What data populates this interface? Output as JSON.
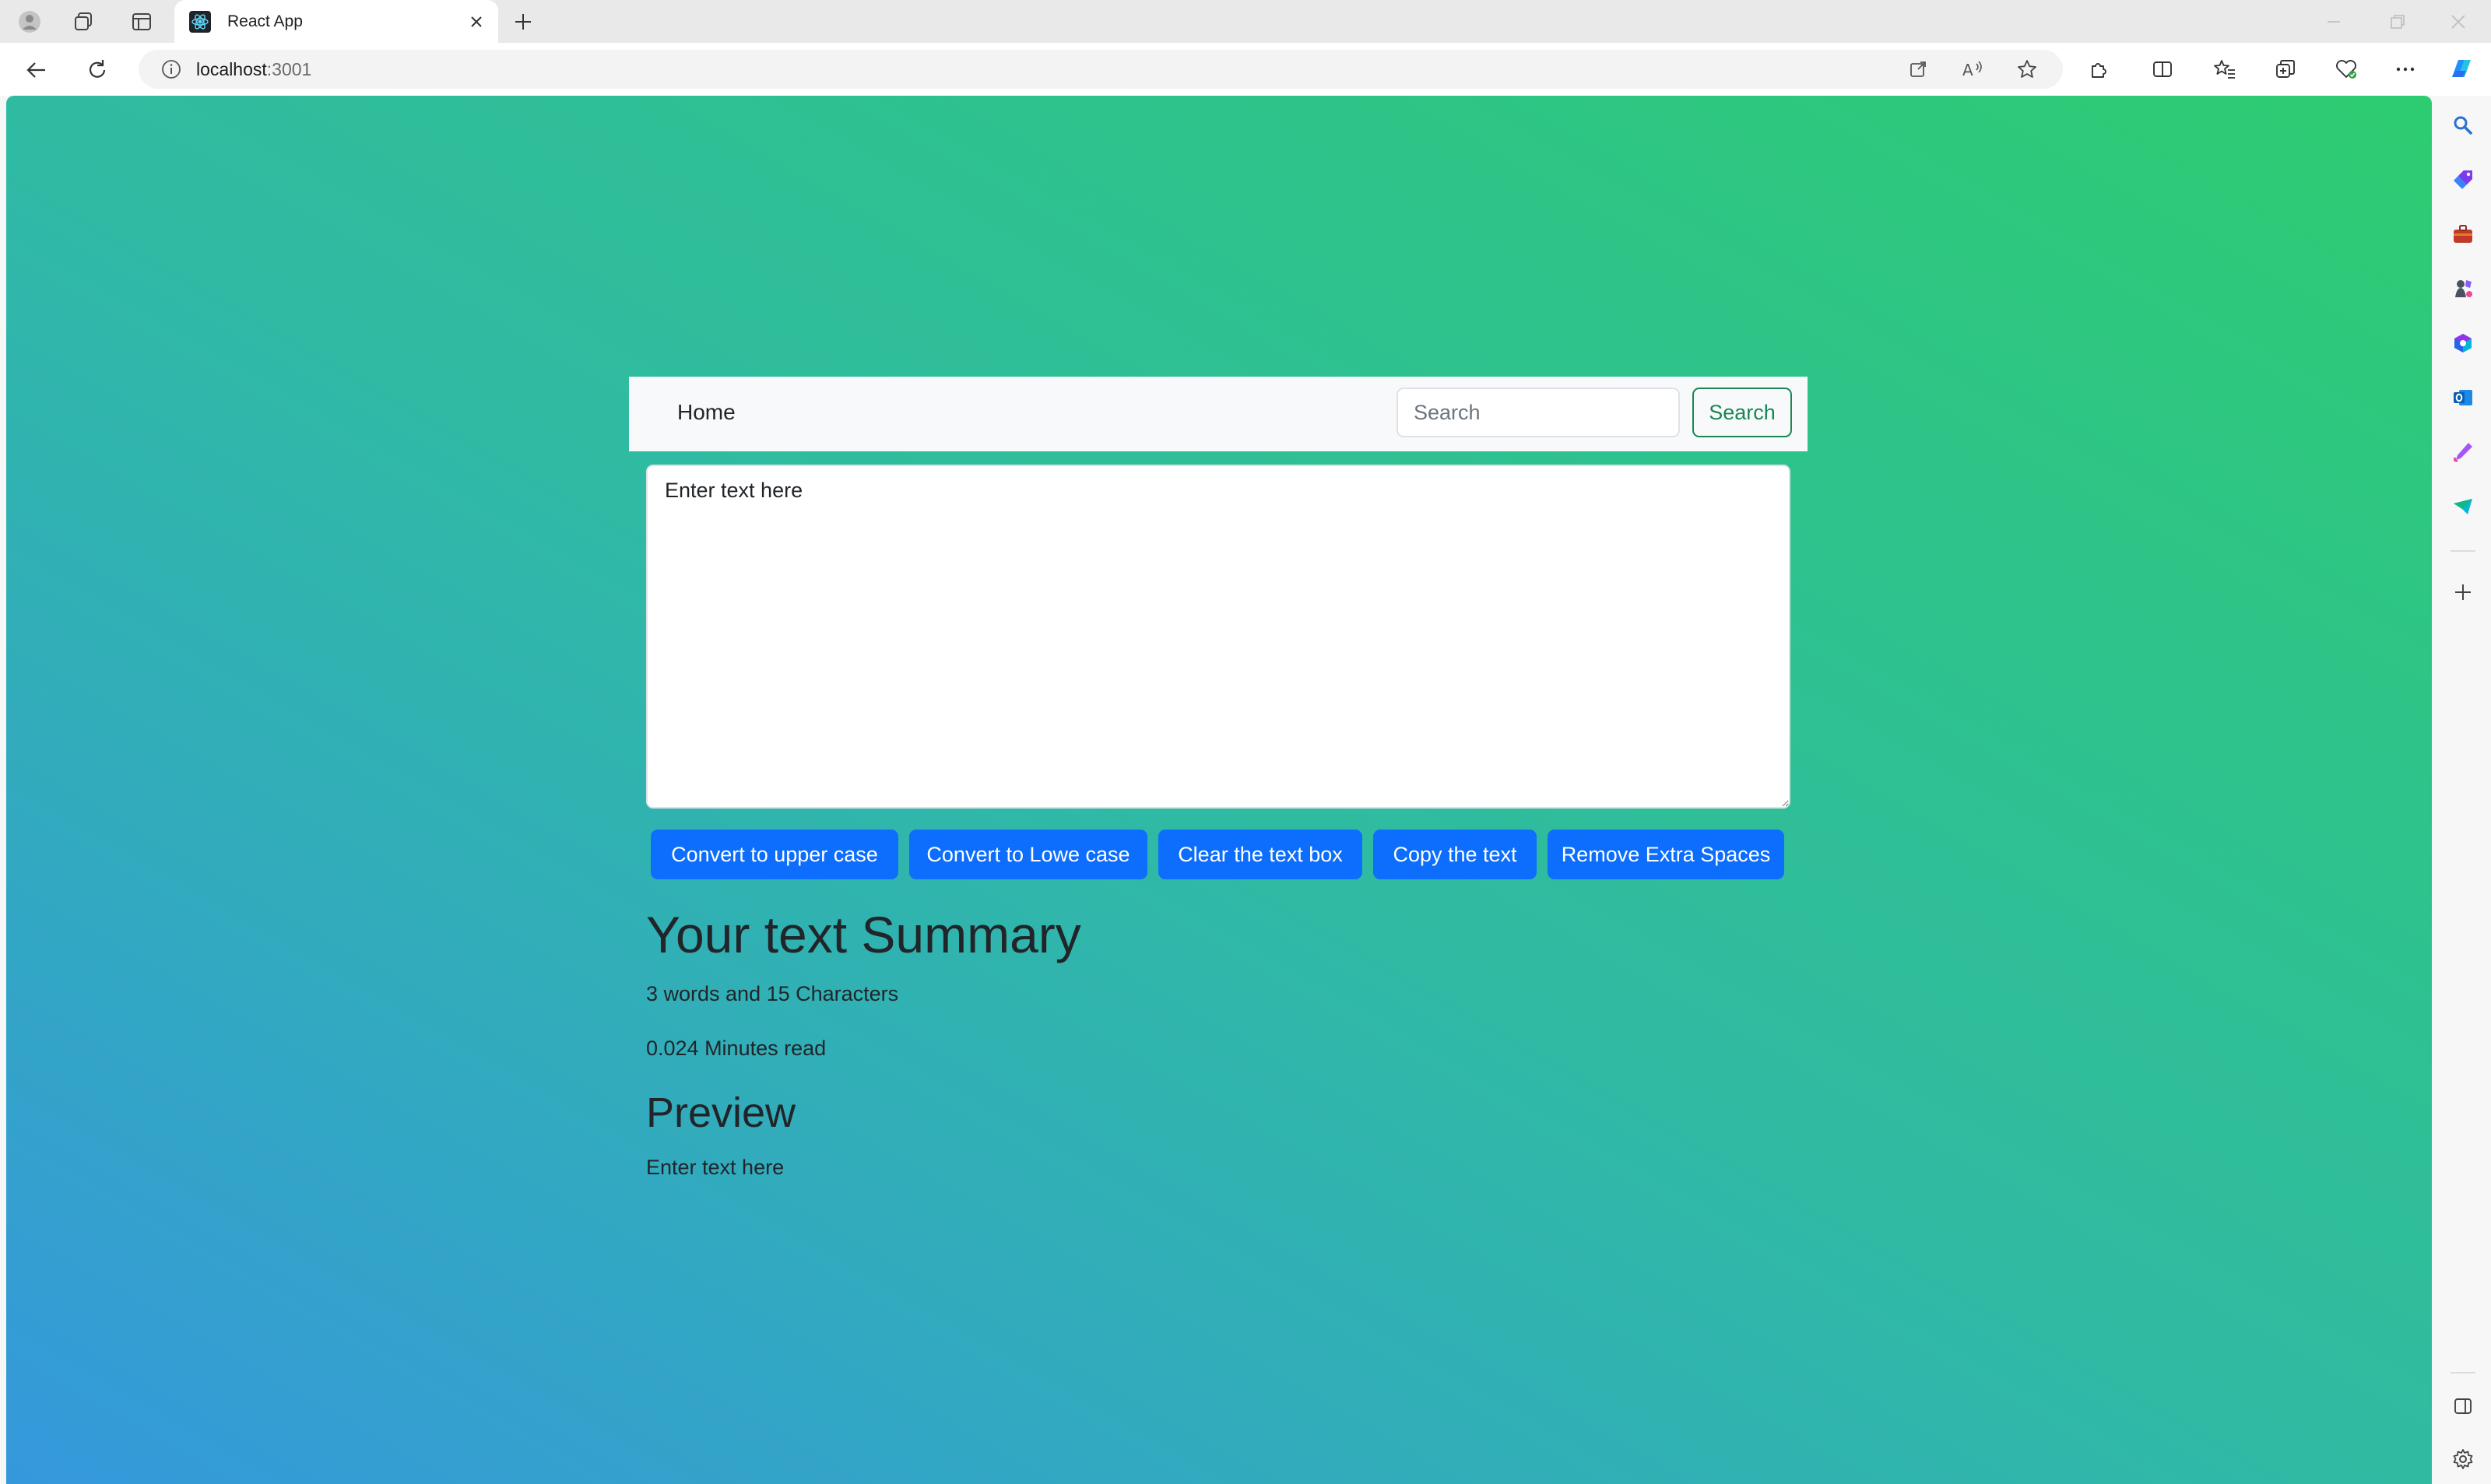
{
  "browser": {
    "tab": {
      "title": "React App",
      "favicon": "react-logo-icon"
    },
    "address": {
      "host": "localhost",
      "port": ":3001"
    }
  },
  "navbar": {
    "home_label": "Home",
    "search_placeholder": "Search",
    "search_button": "Search"
  },
  "editor": {
    "placeholder": "Enter text here"
  },
  "buttons": [
    "Convert to upper case",
    "Convert to Lowe case",
    "Clear the text box",
    "Copy the text",
    "Remove Extra Spaces"
  ],
  "summary": {
    "heading": "Your text Summary",
    "counts": "3 words and 15 Characters",
    "read_time": "0.024 Minutes read"
  },
  "preview": {
    "heading": "Preview",
    "text": "Enter text here"
  },
  "colors": {
    "primary": "#0d6efd",
    "success": "#198754",
    "gradient_start": "#3598dc",
    "gradient_end": "#2ecc71"
  }
}
